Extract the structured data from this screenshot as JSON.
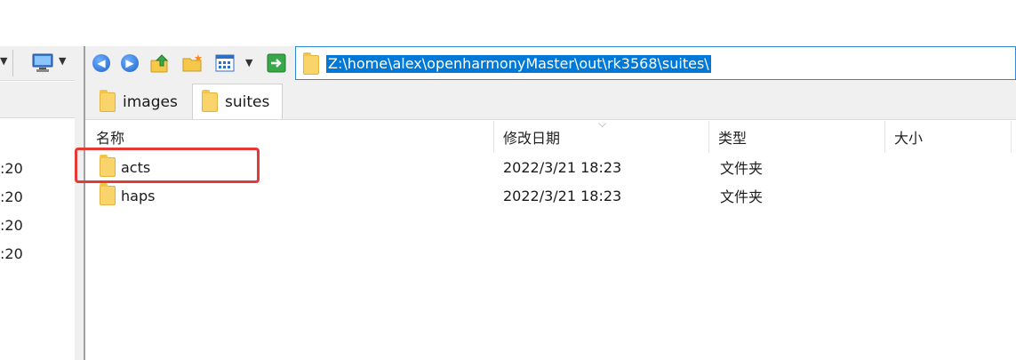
{
  "left_pane": {
    "times": [
      ":20",
      ":20",
      ":20",
      ":20"
    ]
  },
  "toolbar": {
    "back_icon": "back-icon",
    "forward_icon": "forward-icon",
    "up_icon": "parent-folder-icon",
    "new_folder_icon": "new-folder-icon",
    "view_icon": "view-mode-icon",
    "go_icon": "go-icon"
  },
  "address": {
    "path": "Z:\\home\\alex\\openharmonyMaster\\out\\rk3568\\suites\\"
  },
  "tabs": [
    {
      "label": "images"
    },
    {
      "label": "suites"
    }
  ],
  "columns": {
    "name": "名称",
    "date": "修改日期",
    "type": "类型",
    "size": "大小"
  },
  "files": [
    {
      "name": "acts",
      "modified": "2022/3/21 18:23",
      "type": "文件夹",
      "size": ""
    },
    {
      "name": "haps",
      "modified": "2022/3/21 18:23",
      "type": "文件夹",
      "size": ""
    }
  ],
  "colors": {
    "highlight": "#e53935",
    "selection": "#0078d7"
  }
}
